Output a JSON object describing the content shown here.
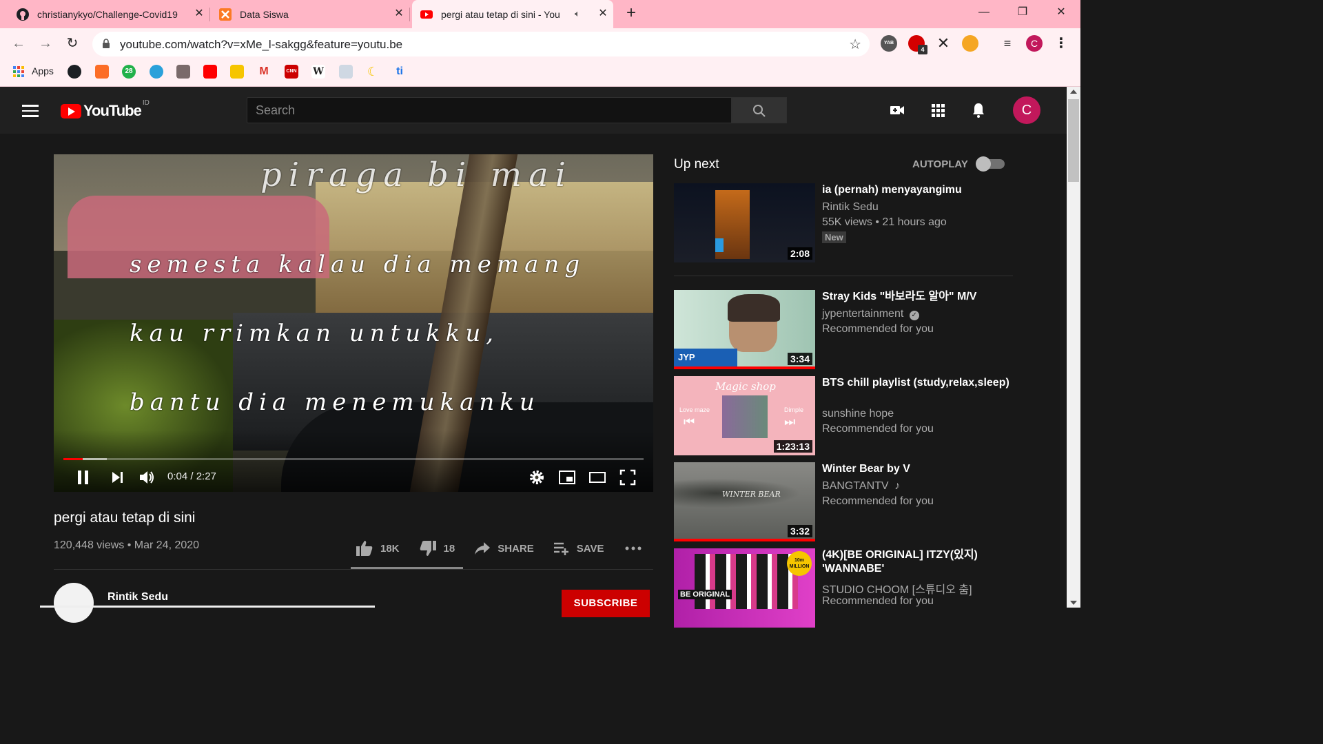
{
  "browser": {
    "tabs": [
      {
        "title": "christianykyo/Challenge-Covid19",
        "favicon": "github-icon",
        "active": false
      },
      {
        "title": "Data Siswa",
        "favicon": "xampp-icon",
        "active": false
      },
      {
        "title": "pergi atau tetap di sini - You",
        "favicon": "youtube-icon",
        "active": true,
        "audio": true
      }
    ],
    "url": "youtube.com/watch?v=xMe_l-sakgg&feature=youtu.be",
    "apps_label": "Apps",
    "extension_badge": "4",
    "profile_initial": "C",
    "bookmark_badge": "28",
    "bookmark_cnn": "CNN",
    "bookmark_wiki": "W",
    "bookmark_ti": "ti",
    "ext_yab": "YAB",
    "colors": {
      "chrome": "#ffb6c6",
      "toolbar": "#fff0f3",
      "profile": "#c2185b"
    }
  },
  "youtube": {
    "logo_text": "YouTube",
    "country_code": "ID",
    "search_placeholder": "Search",
    "avatar_initial": "C",
    "player": {
      "lyrics": [
        "piraga bi mai",
        "semesta kalau dia memang",
        "kau rrimkan untukku,",
        "bantu dia menemukanku"
      ],
      "time": "0:04 / 2:27",
      "played_fraction": 0.033,
      "buffered_fraction": 0.075
    },
    "video": {
      "title": "pergi atau tetap di sini",
      "meta": "120,448 views • Mar 24, 2020",
      "likes": "18K",
      "dislikes": "18",
      "share_label": "SHARE",
      "save_label": "SAVE"
    },
    "channel": {
      "name": "Rintik Sedu",
      "subscribe_label": "SUBSCRIBE"
    },
    "sidebar": {
      "up_next_label": "Up next",
      "autoplay_label": "AUTOPLAY",
      "autoplay_on": false,
      "items": [
        {
          "title": "ia (pernah) menyayangimu",
          "channel": "Rintik Sedu",
          "stats": "55K views • 21 hours ago",
          "badge": "New",
          "duration": "2:08"
        },
        {
          "title": "Stray Kids \"바보라도 알아\" M/V",
          "channel": "jypentertainment",
          "verified": true,
          "stats": "Recommended for you",
          "duration": "3:34",
          "thumb_text": "JYP OFFICIAL",
          "watched": true
        },
        {
          "title": "BTS chill playlist (study,relax,sleep)",
          "channel": "sunshine hope",
          "stats": "Recommended for you",
          "duration": "1:23:13",
          "thumb_text": "Magic shop",
          "thumb_left": "Love maze",
          "thumb_right": "Dimple"
        },
        {
          "title": "Winter Bear by V",
          "channel": "BANGTANTV",
          "music": true,
          "stats": "Recommended for you",
          "duration": "3:32",
          "thumb_text": "WINTER BEAR",
          "watched": true
        },
        {
          "title": "(4K)[BE ORIGINAL] ITZY(있지) 'WANNABE'",
          "channel": "STUDIO CHOOM [스튜디오 춤]",
          "stats": "Recommended for you",
          "thumb_text": "BE ORIGINAL",
          "thumb_badge": "10m MILLION"
        }
      ]
    }
  }
}
